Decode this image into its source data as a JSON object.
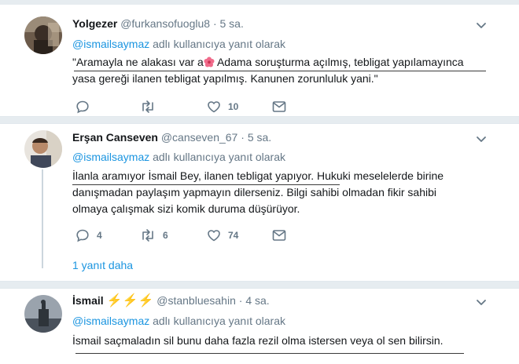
{
  "tweets": [
    {
      "name": "Yolgezer",
      "handle": "@furkansofuoglu8",
      "dot": "·",
      "time": "5 sa.",
      "reply_mention": "@ismailsaymaz",
      "reply_suffix": "adlı kullanıcıya yanıt olarak",
      "text_line1_a": "\"Aramayla ne alakası var a",
      "emoji": "hibiscus-emoji",
      "text_line1_b": "Adama soruşturma açılmış, tebligat yapılamayınca",
      "text_line2": "yasa gereği ilanen tebligat yapılmış. Kanunen zorunluluk yani.\"",
      "replies": "",
      "retweets": "",
      "likes": "10"
    },
    {
      "name": "Erşan Canseven",
      "handle": "@canseven_67",
      "dot": "·",
      "time": "5 sa.",
      "reply_mention": "@ismailsaymaz",
      "reply_suffix": "adlı kullanıcıya yanıt olarak",
      "lines": [
        "İlanla aramıyor İsmail Bey, ilanen tebligat yapıyor. Hukuki meselelerde birine",
        "danışmadan paylaşım yapmayın dilerseniz. Bilgi sahibi olmadan fikir sahibi",
        "olmaya çalışmak sizi komik duruma düşürüyor."
      ],
      "replies": "4",
      "retweets": "6",
      "likes": "74",
      "more_replies": "1 yanıt daha"
    },
    {
      "name": "İsmail",
      "bolts": "⚡⚡⚡",
      "handle": "@stanbluesahin",
      "dot": "·",
      "time": "4 sa.",
      "reply_mention": "@ismailsaymaz",
      "reply_suffix": "adlı kullanıcıya yanıt olarak",
      "text": "İsmail saçmaladın sil bunu daha fazla rezil olma istersen veya ol sen bilirsin."
    }
  ],
  "colors": {
    "link": "#1b95e0",
    "muted": "#657786",
    "text": "#14171a",
    "bolt": "#ffad1f"
  }
}
